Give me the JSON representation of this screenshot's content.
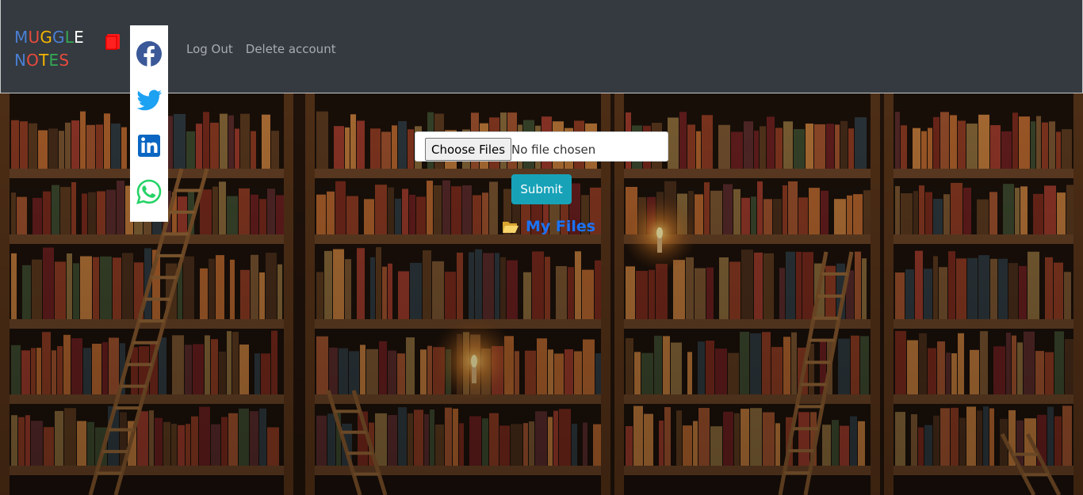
{
  "brand": {
    "line1": [
      {
        "char": "M",
        "color": "#4a7fd4"
      },
      {
        "char": "U",
        "color": "#e84a3c"
      },
      {
        "char": "G",
        "color": "#f4b400"
      },
      {
        "char": "G",
        "color": "#4a7fd4"
      },
      {
        "char": "L",
        "color": "#34a853"
      },
      {
        "char": "E",
        "color": "#ffffff"
      }
    ],
    "line2": [
      {
        "char": "N",
        "color": "#4a7fd4"
      },
      {
        "char": "O",
        "color": "#e84a3c"
      },
      {
        "char": "T",
        "color": "#f4b400"
      },
      {
        "char": "E",
        "color": "#34a853"
      },
      {
        "char": "S",
        "color": "#e84a3c"
      }
    ],
    "icon": "red-book-icon"
  },
  "social": [
    {
      "name": "facebook",
      "icon": "facebook-icon",
      "color": "#3b5998"
    },
    {
      "name": "twitter",
      "icon": "twitter-icon",
      "color": "#1da1f2"
    },
    {
      "name": "linkedin",
      "icon": "linkedin-icon",
      "color": "#0a66c2"
    },
    {
      "name": "whatsapp",
      "icon": "whatsapp-icon",
      "color": "#25d366"
    }
  ],
  "nav": {
    "logout": "Log Out",
    "delete_account": "Delete account"
  },
  "upload": {
    "choose_files": "Choose Files",
    "status": "No file chosen",
    "submit": "Submit",
    "my_files": "My Files",
    "folder_icon": "open-folder-icon"
  },
  "colors": {
    "navbar": "#343a40",
    "submit": "#17a2b8",
    "link": "#1a73f8"
  }
}
